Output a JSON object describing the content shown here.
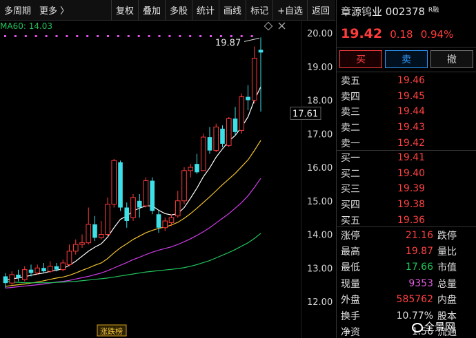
{
  "toolbar": {
    "left": [
      "多周期",
      "更多 〉"
    ],
    "right": [
      "复权",
      "叠加",
      "多股",
      "统计",
      "画线",
      "标记",
      "+自选",
      "返回"
    ]
  },
  "ma": {
    "label": "MA60:",
    "value": "14.03"
  },
  "stock": {
    "name": "章源钨业",
    "code": "002378",
    "tag": "R融",
    "price": "19.42",
    "change": "0.18",
    "change_pct": "0.94%"
  },
  "actions": {
    "buy": "买",
    "sell": "卖",
    "cancel": "撤"
  },
  "asks": [
    {
      "label": "卖五",
      "price": "19.46"
    },
    {
      "label": "卖四",
      "price": "19.45"
    },
    {
      "label": "卖三",
      "price": "19.44"
    },
    {
      "label": "卖二",
      "price": "19.43"
    },
    {
      "label": "卖一",
      "price": "19.42"
    }
  ],
  "bids": [
    {
      "label": "买一",
      "price": "19.41"
    },
    {
      "label": "买二",
      "price": "19.40"
    },
    {
      "label": "买三",
      "price": "19.39"
    },
    {
      "label": "买四",
      "price": "19.38"
    },
    {
      "label": "买五",
      "price": "19.36"
    }
  ],
  "stats": [
    {
      "l1": "涨停",
      "v1": "21.16",
      "c1": "red",
      "l2": "跌停"
    },
    {
      "l1": "最高",
      "v1": "19.87",
      "c1": "red",
      "l2": "量比"
    },
    {
      "l1": "最低",
      "v1": "17.66",
      "c1": "green",
      "l2": "市值"
    },
    {
      "l1": "现量",
      "v1": "9353",
      "c1": "mag",
      "l2": "总量"
    },
    {
      "l1": "外盘",
      "v1": "585762",
      "c1": "red",
      "l2": "内盘"
    },
    {
      "l1": "换手",
      "v1": "10.77%",
      "c1": "white",
      "l2": "股本"
    },
    {
      "l1": "净资",
      "v1": "1.56",
      "c1": "white",
      "l2": "流通"
    }
  ],
  "watermark": "全景网",
  "chart_data": {
    "type": "candlestick",
    "y_ticks": [
      "20.00",
      "19.00",
      "18.00",
      "17.00",
      "16.00",
      "15.00",
      "14.00",
      "13.00",
      "12.00"
    ],
    "ylim": [
      11.75,
      20.35
    ],
    "current_price_marker": "17.61",
    "high_annotation": "19.87",
    "badge": "涨跌榜",
    "candles": [
      {
        "o": 12.75,
        "c": 12.55,
        "h": 12.85,
        "l": 12.4
      },
      {
        "o": 12.55,
        "c": 12.8,
        "h": 12.9,
        "l": 12.5
      },
      {
        "o": 12.8,
        "c": 12.7,
        "h": 12.95,
        "l": 12.6
      },
      {
        "o": 12.65,
        "c": 12.95,
        "h": 13.05,
        "l": 12.6
      },
      {
        "o": 12.95,
        "c": 12.85,
        "h": 13.1,
        "l": 12.75
      },
      {
        "o": 12.85,
        "c": 13.0,
        "h": 13.1,
        "l": 12.8
      },
      {
        "o": 13.0,
        "c": 12.9,
        "h": 13.15,
        "l": 12.85
      },
      {
        "o": 12.9,
        "c": 13.05,
        "h": 13.2,
        "l": 12.85
      },
      {
        "o": 13.05,
        "c": 12.95,
        "h": 13.15,
        "l": 12.9
      },
      {
        "o": 12.95,
        "c": 13.15,
        "h": 13.25,
        "l": 12.9
      },
      {
        "o": 13.1,
        "c": 13.5,
        "h": 13.7,
        "l": 13.05
      },
      {
        "o": 13.5,
        "c": 13.7,
        "h": 13.85,
        "l": 13.4
      },
      {
        "o": 13.7,
        "c": 13.75,
        "h": 14.0,
        "l": 13.6
      },
      {
        "o": 13.75,
        "c": 14.3,
        "h": 14.8,
        "l": 13.7
      },
      {
        "o": 14.3,
        "c": 13.9,
        "h": 14.55,
        "l": 13.8
      },
      {
        "o": 13.9,
        "c": 14.0,
        "h": 14.4,
        "l": 13.85
      },
      {
        "o": 14.0,
        "c": 14.9,
        "h": 15.1,
        "l": 13.95
      },
      {
        "o": 14.9,
        "c": 16.2,
        "h": 16.25,
        "l": 14.8
      },
      {
        "o": 16.15,
        "c": 14.8,
        "h": 16.2,
        "l": 14.7
      },
      {
        "o": 14.8,
        "c": 14.4,
        "h": 14.95,
        "l": 14.2
      },
      {
        "o": 14.5,
        "c": 15.1,
        "h": 15.2,
        "l": 14.4
      },
      {
        "o": 15.0,
        "c": 14.8,
        "h": 15.2,
        "l": 14.5
      },
      {
        "o": 14.85,
        "c": 15.6,
        "h": 15.7,
        "l": 14.8
      },
      {
        "o": 15.6,
        "c": 14.7,
        "h": 15.7,
        "l": 14.6
      },
      {
        "o": 14.6,
        "c": 14.2,
        "h": 14.7,
        "l": 14.05
      },
      {
        "o": 14.2,
        "c": 14.4,
        "h": 14.5,
        "l": 14.1
      },
      {
        "o": 14.35,
        "c": 14.5,
        "h": 14.6,
        "l": 14.25
      },
      {
        "o": 14.55,
        "c": 15.0,
        "h": 15.3,
        "l": 14.5
      },
      {
        "o": 15.0,
        "c": 15.9,
        "h": 16.0,
        "l": 14.9
      },
      {
        "o": 15.9,
        "c": 16.0,
        "h": 16.1,
        "l": 15.7
      },
      {
        "o": 16.1,
        "c": 15.85,
        "h": 16.4,
        "l": 15.8
      },
      {
        "o": 15.9,
        "c": 16.9,
        "h": 17.0,
        "l": 15.9
      },
      {
        "o": 16.9,
        "c": 16.5,
        "h": 17.2,
        "l": 16.4
      },
      {
        "o": 16.5,
        "c": 17.2,
        "h": 17.3,
        "l": 16.45
      },
      {
        "o": 17.15,
        "c": 16.7,
        "h": 17.25,
        "l": 16.6
      },
      {
        "o": 16.65,
        "c": 17.45,
        "h": 17.5,
        "l": 16.6
      },
      {
        "o": 17.45,
        "c": 17.05,
        "h": 17.8,
        "l": 16.95
      },
      {
        "o": 17.1,
        "c": 18.1,
        "h": 18.2,
        "l": 17.0
      },
      {
        "o": 18.1,
        "c": 18.0,
        "h": 18.45,
        "l": 17.7
      },
      {
        "o": 18.0,
        "c": 19.25,
        "h": 19.6,
        "l": 17.9
      },
      {
        "o": 19.5,
        "c": 19.42,
        "h": 19.87,
        "l": 17.66
      }
    ],
    "ma": [
      {
        "name": "",
        "color": "#ffffff",
        "values": [
          12.62,
          12.68,
          12.7,
          12.74,
          12.78,
          12.82,
          12.85,
          12.9,
          12.93,
          12.98,
          13.08,
          13.2,
          13.35,
          13.5,
          13.62,
          13.72,
          13.92,
          14.2,
          14.45,
          14.55,
          14.7,
          14.78,
          14.85,
          14.85,
          14.72,
          14.62,
          14.58,
          14.62,
          14.8,
          15.08,
          15.38,
          15.72,
          15.98,
          16.3,
          16.55,
          16.78,
          16.95,
          17.2,
          17.5,
          18.0,
          18.4
        ]
      },
      {
        "name": "",
        "color": "#f2c230",
        "values": [
          12.45,
          12.48,
          12.5,
          12.52,
          12.55,
          12.58,
          12.62,
          12.66,
          12.7,
          12.73,
          12.78,
          12.85,
          12.93,
          13.0,
          13.08,
          13.15,
          13.28,
          13.45,
          13.6,
          13.72,
          13.85,
          13.95,
          14.05,
          14.12,
          14.18,
          14.22,
          14.28,
          14.36,
          14.48,
          14.62,
          14.78,
          14.95,
          15.12,
          15.3,
          15.48,
          15.65,
          15.82,
          16.02,
          16.22,
          16.5,
          16.8
        ]
      },
      {
        "name": "",
        "color": "#d03ce8",
        "values": [
          12.4,
          12.42,
          12.44,
          12.46,
          12.48,
          12.5,
          12.52,
          12.55,
          12.58,
          12.6,
          12.63,
          12.67,
          12.71,
          12.75,
          12.8,
          12.85,
          12.92,
          13.0,
          13.08,
          13.16,
          13.25,
          13.32,
          13.4,
          13.47,
          13.53,
          13.58,
          13.63,
          13.7,
          13.78,
          13.87,
          13.97,
          14.08,
          14.2,
          14.34,
          14.48,
          14.62,
          14.78,
          14.95,
          15.15,
          15.4,
          15.67
        ]
      },
      {
        "name": "MA60",
        "color": "#22c35b",
        "values": [
          12.6,
          12.58,
          12.57,
          12.56,
          12.56,
          12.56,
          12.56,
          12.56,
          12.57,
          12.58,
          12.59,
          12.6,
          12.62,
          12.64,
          12.66,
          12.68,
          12.7,
          12.73,
          12.76,
          12.79,
          12.82,
          12.85,
          12.88,
          12.9,
          12.92,
          12.94,
          12.96,
          12.98,
          13.01,
          13.05,
          13.1,
          13.16,
          13.22,
          13.3,
          13.38,
          13.46,
          13.55,
          13.65,
          13.75,
          13.88,
          14.03
        ]
      }
    ]
  }
}
